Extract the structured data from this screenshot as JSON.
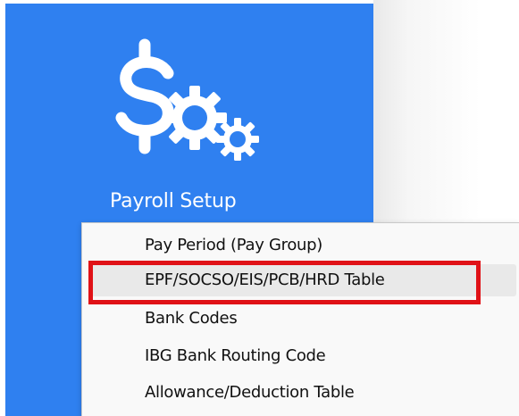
{
  "tile": {
    "icon": "dollar-gears-icon",
    "label": "Payroll Setup",
    "color": "#2f80f0"
  },
  "menu": {
    "items": [
      {
        "label": "Pay Period (Pay Group)"
      },
      {
        "label": "EPF/SOCSO/EIS/PCB/HRD Table",
        "state": "hovered-highlighted"
      },
      {
        "label": "Bank Codes"
      },
      {
        "label": "IBG Bank Routing Code"
      },
      {
        "label": "Allowance/Deduction Table"
      }
    ]
  },
  "annotation": {
    "color": "#e01217"
  }
}
